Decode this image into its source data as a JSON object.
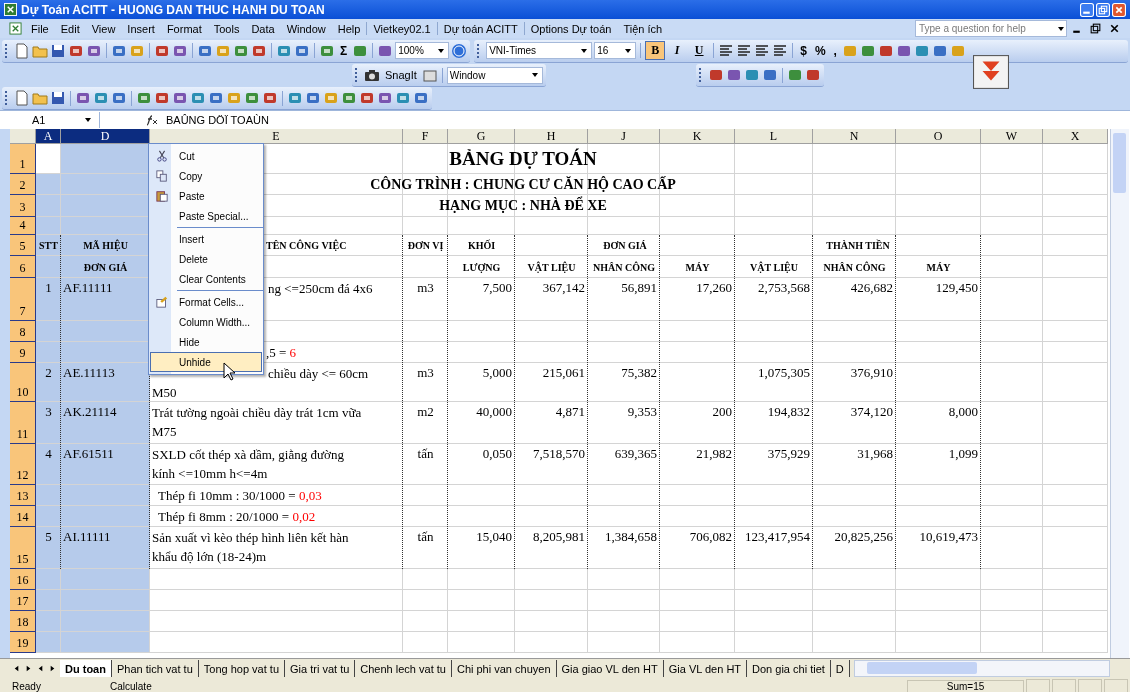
{
  "window": {
    "title": "Dự Toán ACITT - HUONG DAN THUC HANH DU TOAN"
  },
  "menu_bar": {
    "items": [
      "File",
      "Edit",
      "View",
      "Insert",
      "Format",
      "Tools",
      "Data",
      "Window",
      "Help"
    ],
    "addin_items": [
      "Vietkey02.1",
      "Dự toán ACITT",
      "Options Dự toán",
      "Tiện ích"
    ],
    "help_placeholder": "Type a question for help"
  },
  "standard_toolbar": {
    "sum_symbol": "Σ",
    "zoom": "100%"
  },
  "formatting_toolbar": {
    "font": "VNI-Times",
    "size": "16",
    "style_buttons": [
      {
        "label": "B",
        "selected": true
      },
      {
        "label": "I",
        "selected": false
      },
      {
        "label": "U",
        "selected": false
      }
    ],
    "symbols": [
      "$",
      "%",
      ","
    ]
  },
  "snagit_toolbar": {
    "label": "SnagIt",
    "dropdown": "Window"
  },
  "formula_bar": {
    "name_box": "A1",
    "formula": "BAÛNG DÖÏ TOAÙN"
  },
  "sheet": {
    "columns": [
      {
        "label": "A",
        "selected": true
      },
      {
        "label": "D",
        "selected": true
      },
      {
        "label": "E",
        "selected": false
      },
      {
        "label": "F",
        "selected": false
      },
      {
        "label": "G",
        "selected": false
      },
      {
        "label": "H",
        "selected": false
      },
      {
        "label": "J",
        "selected": false
      },
      {
        "label": "K",
        "selected": false
      },
      {
        "label": "L",
        "selected": false
      },
      {
        "label": "N",
        "selected": false
      },
      {
        "label": "O",
        "selected": false
      },
      {
        "label": "W",
        "selected": false
      },
      {
        "label": "X",
        "selected": false
      }
    ],
    "row_headers": [
      {
        "label": "1",
        "selected": true
      },
      {
        "label": "2",
        "selected": true
      },
      {
        "label": "3",
        "selected": true
      },
      {
        "label": "4",
        "selected": true
      },
      {
        "label": "5",
        "selected": true
      },
      {
        "label": "6",
        "selected": true
      },
      {
        "label": "7",
        "selected": true
      },
      {
        "label": "8",
        "selected": true
      },
      {
        "label": "9",
        "selected": true
      },
      {
        "label": "10",
        "selected": true
      },
      {
        "label": "11",
        "selected": true
      },
      {
        "label": "12",
        "selected": true
      },
      {
        "label": "13",
        "selected": true
      },
      {
        "label": "14",
        "selected": true
      },
      {
        "label": "15",
        "selected": true
      },
      {
        "label": "16",
        "selected": true
      },
      {
        "label": "17",
        "selected": true
      },
      {
        "label": "18",
        "selected": true
      },
      {
        "label": "19",
        "selected": true
      }
    ],
    "title": "BẢNG DỰ TOÁN",
    "subtitle": "CÔNG TRÌNH : CHUNG CƯ CĂN HỘ CAO CẤP",
    "category": "HẠNG MỤC : NHÀ ĐỂ XE",
    "header": {
      "stt": "STT",
      "code_1": "MÃ HIỆU",
      "code_2": "ĐƠN GIÁ",
      "name": "TÊN CÔNG VIỆC",
      "unit": "ĐƠN VỊ",
      "qty_1": "KHỐI",
      "qty_2": "LƯỢNG",
      "unit_price": "ĐƠN GIÁ",
      "total": "THÀNH TIỀN",
      "unit_price_parts": [
        "VẬT LIỆU",
        "NHÂN CÔNG",
        "MÁY"
      ],
      "total_parts": [
        "VẬT LIỆU",
        "NHÂN CÔNG",
        "MÁY"
      ]
    },
    "body_rows": [
      {
        "kind": "item",
        "stt": "1",
        "code": "AF.11111",
        "lines": [
          {
            "text": "ng <=250cm đá 4x6",
            "covered": true
          }
        ],
        "unit": "m3",
        "qty": "7,500",
        "values": {
          "price_material": "367,142",
          "price_labor": "56,891",
          "price_machine": "17,260",
          "total_material": "2,753,568",
          "total_labor": "426,682",
          "total_machine": "129,450"
        }
      },
      {
        "kind": "blank"
      },
      {
        "kind": "note",
        "covered": true,
        "parts": [
          {
            "text": ",5 = ",
            "emphasis": false
          },
          {
            "text": "6",
            "emphasis": true
          }
        ]
      },
      {
        "kind": "item",
        "stt": "2",
        "code": "AE.11113",
        "lines": [
          {
            "text": "chiều dày <= 60cm",
            "covered": true
          },
          {
            "text": "M50",
            "covered": false
          }
        ],
        "unit": "m3",
        "qty": "5,000",
        "values": {
          "price_material": "215,061",
          "price_labor": "75,382",
          "total_material": "1,075,305",
          "total_labor": "376,910"
        }
      },
      {
        "kind": "item",
        "stt": "3",
        "code": "AK.21114",
        "lines": [
          {
            "text": "Trát tường ngoài chiều dày trát 1cm vữa",
            "covered": false
          },
          {
            "text": "M75",
            "covered": false
          }
        ],
        "unit": "m2",
        "qty": "40,000",
        "values": {
          "price_material": "4,871",
          "price_labor": "9,353",
          "price_machine": "200",
          "total_material": "194,832",
          "total_labor": "374,120",
          "total_machine": "8,000"
        }
      },
      {
        "kind": "item",
        "stt": "4",
        "code": "AF.61511",
        "lines": [
          {
            "text": "SXLD cốt thép xà dầm, giằng đường",
            "covered": false
          },
          {
            "text": "kính <=10mm h<=4m",
            "covered": false
          }
        ],
        "unit": "tấn",
        "qty": "0,050",
        "values": {
          "price_material": "7,518,570",
          "price_labor": "639,365",
          "price_machine": "21,982",
          "total_material": "375,929",
          "total_labor": "31,968",
          "total_machine": "1,099"
        }
      },
      {
        "kind": "note",
        "covered": false,
        "parts": [
          {
            "text": "Thép fi 10mm  : 30/1000 = ",
            "emphasis": false
          },
          {
            "text": "0,03",
            "emphasis": true
          }
        ]
      },
      {
        "kind": "note",
        "covered": false,
        "parts": [
          {
            "text": "Thép fi 8mm  : 20/1000 = ",
            "emphasis": false
          },
          {
            "text": "0,02",
            "emphasis": true
          }
        ]
      },
      {
        "kind": "item",
        "stt": "5",
        "code": "AI.11111",
        "lines": [
          {
            "text": "Sản xuất vì kèo thép hình liên kết hàn",
            "covered": false
          },
          {
            "text": "khẩu độ lớn (18-24)m",
            "covered": false
          }
        ],
        "unit": "tấn",
        "qty": "15,040",
        "values": {
          "price_material": "8,205,981",
          "price_labor": "1,384,658",
          "price_machine": "706,082",
          "total_material": "123,417,954",
          "total_labor": "20,825,256",
          "total_machine": "10,619,473"
        }
      }
    ]
  },
  "context_menu": {
    "items": [
      {
        "label": "Cut",
        "separator_before": false,
        "highlighted": false
      },
      {
        "label": "Copy",
        "separator_before": false,
        "highlighted": false
      },
      {
        "label": "Paste",
        "separator_before": false,
        "highlighted": false
      },
      {
        "label": "Paste Special...",
        "separator_before": false,
        "highlighted": false
      },
      {
        "label": "Insert",
        "separator_before": true,
        "highlighted": false
      },
      {
        "label": "Delete",
        "separator_before": false,
        "highlighted": false
      },
      {
        "label": "Clear Contents",
        "separator_before": false,
        "highlighted": false
      },
      {
        "label": "Format Cells...",
        "separator_before": true,
        "highlighted": false
      },
      {
        "label": "Column Width...",
        "separator_before": false,
        "highlighted": false
      },
      {
        "label": "Hide",
        "separator_before": false,
        "highlighted": false
      },
      {
        "label": "Unhide",
        "separator_before": false,
        "highlighted": true
      }
    ]
  },
  "sheet_tabs": [
    {
      "label": "Du toan",
      "selected": true
    },
    {
      "label": "Phan tich vat tu",
      "selected": false
    },
    {
      "label": "Tong hop vat tu",
      "selected": false
    },
    {
      "label": "Gia tri vat tu",
      "selected": false
    },
    {
      "label": "Chenh lech vat tu",
      "selected": false
    },
    {
      "label": "Chi phi van chuyen",
      "selected": false
    },
    {
      "label": "Gia giao VL den HT",
      "selected": false
    },
    {
      "label": "Gia VL den HT",
      "selected": false
    },
    {
      "label": "Don gia chi tiet",
      "selected": false
    },
    {
      "label": "D",
      "selected": false
    }
  ],
  "status_bar": {
    "mode": "Ready",
    "calc": "Calculate",
    "sum": "Sum=15"
  }
}
